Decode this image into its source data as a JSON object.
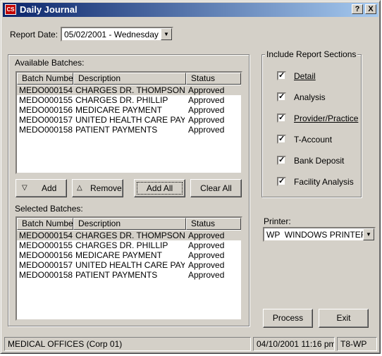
{
  "window": {
    "title": "Daily Journal",
    "app_icon_text": "CS",
    "help_label": "?",
    "close_label": "X"
  },
  "report_date": {
    "label": "Report Date:",
    "value": "05/02/2001 - Wednesday"
  },
  "available": {
    "label": "Available Batches:",
    "columns": [
      "Batch Number",
      "Description",
      "Status"
    ],
    "rows": [
      {
        "batch": "MEDO000154",
        "description": "CHARGES DR. THOMPSON",
        "status": "Approved"
      },
      {
        "batch": "MEDO000155",
        "description": "CHARGES DR. PHILLIP",
        "status": "Approved"
      },
      {
        "batch": "MEDO000156",
        "description": "MEDICARE PAYMENT",
        "status": "Approved"
      },
      {
        "batch": "MEDO000157",
        "description": "UNITED HEALTH CARE PAY...",
        "status": "Approved"
      },
      {
        "batch": "MEDO000158",
        "description": "PATIENT PAYMENTS",
        "status": "Approved"
      }
    ]
  },
  "buttons": {
    "add": "Add",
    "remove": "Remove",
    "add_all": "Add All",
    "clear_all": "Clear All"
  },
  "selected": {
    "label": "Selected Batches:",
    "columns": [
      "Batch Number",
      "Description",
      "Status"
    ],
    "rows": [
      {
        "batch": "MEDO000154",
        "description": "CHARGES DR. THOMPSON",
        "status": "Approved"
      },
      {
        "batch": "MEDO000155",
        "description": "CHARGES DR. PHILLIP",
        "status": "Approved"
      },
      {
        "batch": "MEDO000156",
        "description": "MEDICARE PAYMENT",
        "status": "Approved"
      },
      {
        "batch": "MEDO000157",
        "description": "UNITED HEALTH CARE PAY...",
        "status": "Approved"
      },
      {
        "batch": "MEDO000158",
        "description": "PATIENT PAYMENTS",
        "status": "Approved"
      }
    ]
  },
  "sections": {
    "title": "Include Report Sections",
    "items": [
      {
        "label": "Detail",
        "checked": true
      },
      {
        "label": "Analysis",
        "checked": true
      },
      {
        "label": "Provider/Practice",
        "checked": true
      },
      {
        "label": "T-Account",
        "checked": true
      },
      {
        "label": "Bank Deposit",
        "checked": true
      },
      {
        "label": "Facility Analysis",
        "checked": true
      }
    ]
  },
  "printer": {
    "label": "Printer:",
    "value": "WP  WINDOWS PRINTER"
  },
  "actions": {
    "process": "Process",
    "exit": "Exit"
  },
  "statusbar": {
    "company": "MEDICAL OFFICES (Corp 01)",
    "datetime": "04/10/2001 11:16 pm",
    "station": "T8-WP"
  }
}
